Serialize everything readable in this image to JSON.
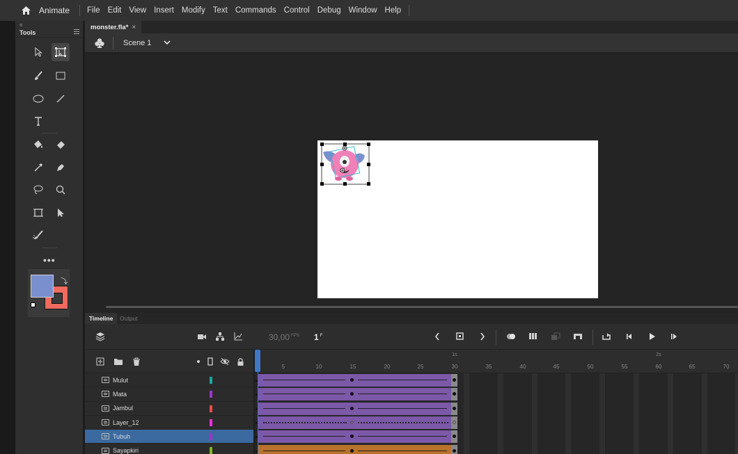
{
  "app": {
    "name": "Animate"
  },
  "menu": [
    "File",
    "Edit",
    "View",
    "Insert",
    "Modify",
    "Text",
    "Commands",
    "Control",
    "Debug",
    "Window",
    "Help"
  ],
  "tools_panel": {
    "collapse": "«",
    "title": "Tools",
    "more": "•••",
    "fill_color": "#7a8fce",
    "stroke_color": "#ef6b5e"
  },
  "document": {
    "tab": "monster.fla*",
    "close": "×",
    "scene": "Scene 1"
  },
  "timeline": {
    "tabs": [
      "Timeline",
      "Output"
    ],
    "fps": "30,00",
    "fps_unit": "FPS",
    "current_frame": "1",
    "frame_unit": "F",
    "ruler_ticks": [
      "5",
      "10",
      "15",
      "20",
      "25",
      "30",
      "35",
      "40",
      "45",
      "50",
      "55",
      "60",
      "65",
      "70"
    ],
    "ruler_seconds": [
      "1s",
      "2s"
    ],
    "layers": [
      {
        "name": "Mulut",
        "color": "#1aa9a0",
        "span": "#7c58a8",
        "style": "tween"
      },
      {
        "name": "Mata",
        "color": "#9b35c9",
        "span": "#7c58a8",
        "style": "tween"
      },
      {
        "name": "Jambul",
        "color": "#ef4b4b",
        "span": "#7c58a8",
        "style": "tween"
      },
      {
        "name": "Layer_12",
        "color": "#ef2fd7",
        "span": "#7c58a8",
        "style": "broken"
      },
      {
        "name": "Tubuh",
        "color": "#9b35c9",
        "span": "#7c58a8",
        "style": "tween",
        "selected": true
      },
      {
        "name": "Sayapkiri",
        "color": "#7fb81f",
        "span": "#b8722b",
        "style": "tween"
      }
    ]
  }
}
